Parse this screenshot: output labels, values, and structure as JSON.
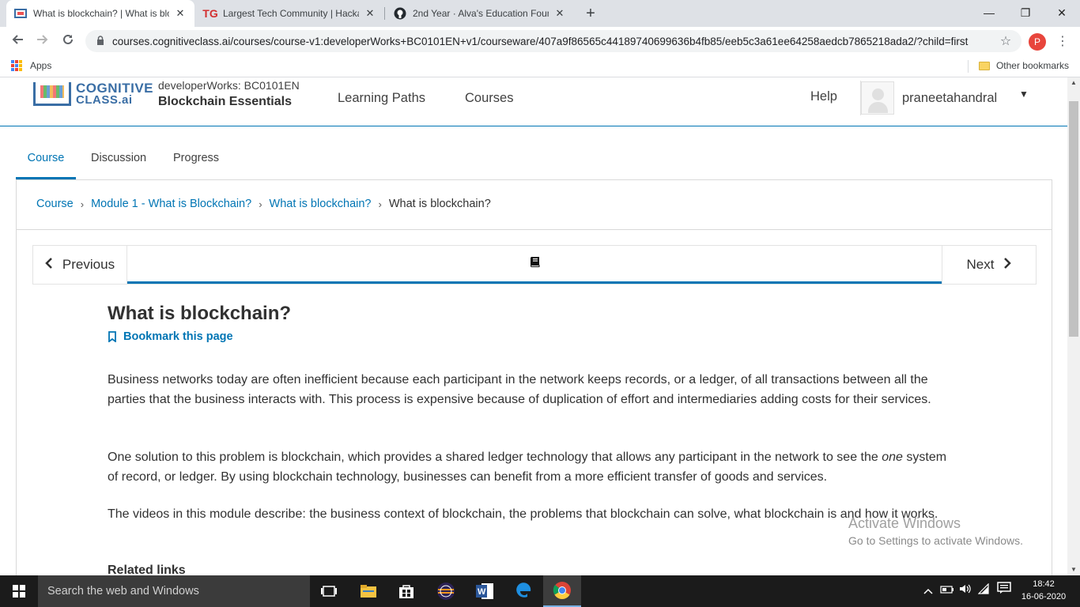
{
  "browser": {
    "tabs": [
      {
        "title": "What is blockchain? | What is blo",
        "favicon": "cognitive-class-icon",
        "active": true
      },
      {
        "title": "Largest Tech Community | Hackat",
        "favicon": "tg-icon",
        "favicon_text": "TG",
        "active": false
      },
      {
        "title": "2nd Year · Alva's Education Found",
        "favicon": "github-icon",
        "active": false
      }
    ],
    "new_tab": "+",
    "window_controls": {
      "minimize": "—",
      "maximize": "❐",
      "close": "✕"
    },
    "url": "courses.cognitiveclass.ai/courses/course-v1:developerWorks+BC0101EN+v1/courseware/407a9f86565c44189740699636b4fb85/eeb5c3a61ee64258aedcb7865218ada2/?child=first",
    "profile_initial": "P",
    "bookmarks": {
      "apps": "Apps",
      "other": "Other bookmarks"
    }
  },
  "site": {
    "logo_line1": "COGNITIVE",
    "logo_line2": "CLASS.ai",
    "course_code": "developerWorks: BC0101EN",
    "course_name": "Blockchain Essentials",
    "nav": [
      "Learning Paths",
      "Courses"
    ],
    "help": "Help",
    "username": "praneetahandral"
  },
  "course_tabs": [
    "Course",
    "Discussion",
    "Progress"
  ],
  "breadcrumbs": {
    "items": [
      "Course",
      "Module 1 - What is Blockchain?",
      "What is blockchain?"
    ],
    "current": "What is blockchain?"
  },
  "sequence": {
    "previous": "Previous",
    "next": "Next"
  },
  "unit": {
    "title": "What is blockchain?",
    "bookmark": "Bookmark this page",
    "p1": "Business networks today are often inefficient because each participant in the network keeps records, or a ledger, of all transactions between all the parties that the business interacts with. This process is expensive because of duplication of effort and intermediaries adding costs for their services.",
    "p2_before": "One solution to this problem is blockchain, which provides a shared ledger technology that allows any participant in the network to see the ",
    "p2_em": "one",
    "p2_after": " system of record, or ledger. By using blockchain technology, businesses can benefit from a more efficient transfer of goods and services.",
    "p3": "The videos in this module describe: the business context of blockchain, the problems that blockchain can solve, what blockchain is and how it works.",
    "related": "Related links"
  },
  "watermark": {
    "line1": "Activate Windows",
    "line2": "Go to Settings to activate Windows."
  },
  "taskbar": {
    "search_placeholder": "Search the web and Windows",
    "time": "18:42",
    "date": "16-06-2020"
  }
}
